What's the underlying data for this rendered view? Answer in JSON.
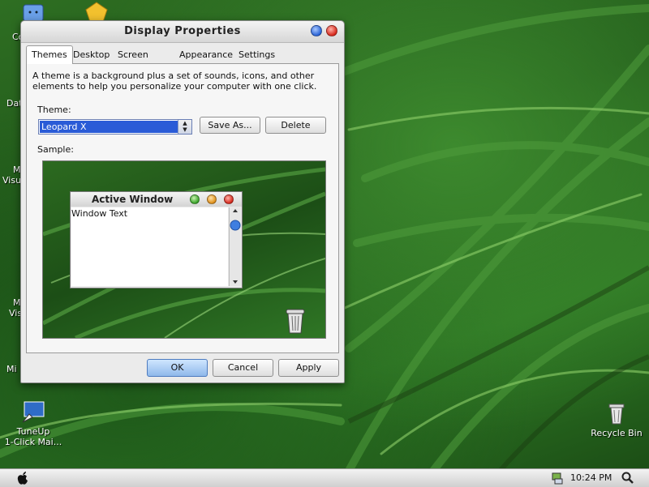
{
  "window": {
    "title": "Display Properties",
    "tabs": [
      "Themes",
      "Desktop",
      "Screen Saver",
      "Appearance",
      "Settings"
    ],
    "active_tab": "Themes",
    "description": "A theme is a background plus a set of sounds, icons, and other elements to help you personalize your computer with one click.",
    "theme_label": "Theme:",
    "theme_value": "Leopard X",
    "save_as_label": "Save As...",
    "delete_label": "Delete",
    "sample_label": "Sample:",
    "sample": {
      "window_title": "Active Window",
      "window_text": "Window Text"
    },
    "ok_label": "OK",
    "cancel_label": "Cancel",
    "apply_label": "Apply"
  },
  "desktop": {
    "icons": [
      {
        "name": "Co",
        "icon": "finder-icon"
      },
      {
        "name": "Dat",
        "icon": "folder-icon"
      },
      {
        "name": "M\nVisu",
        "icon": "app-icon"
      },
      {
        "name": "M\nVis",
        "icon": "app-icon"
      },
      {
        "name": "Mi",
        "icon": "app-icon"
      },
      {
        "name": "TuneUp\n1-Click Mai...",
        "icon": "tuneup-icon"
      },
      {
        "name": "Recycle Bin",
        "icon": "recycle-bin-icon"
      }
    ]
  },
  "taskbar": {
    "clock": "10:24 PM"
  },
  "colors": {
    "selection": "#2a5bd7",
    "help_button": "#2a63d6",
    "close_button": "#d6281c",
    "grass": "#2e6e22"
  }
}
